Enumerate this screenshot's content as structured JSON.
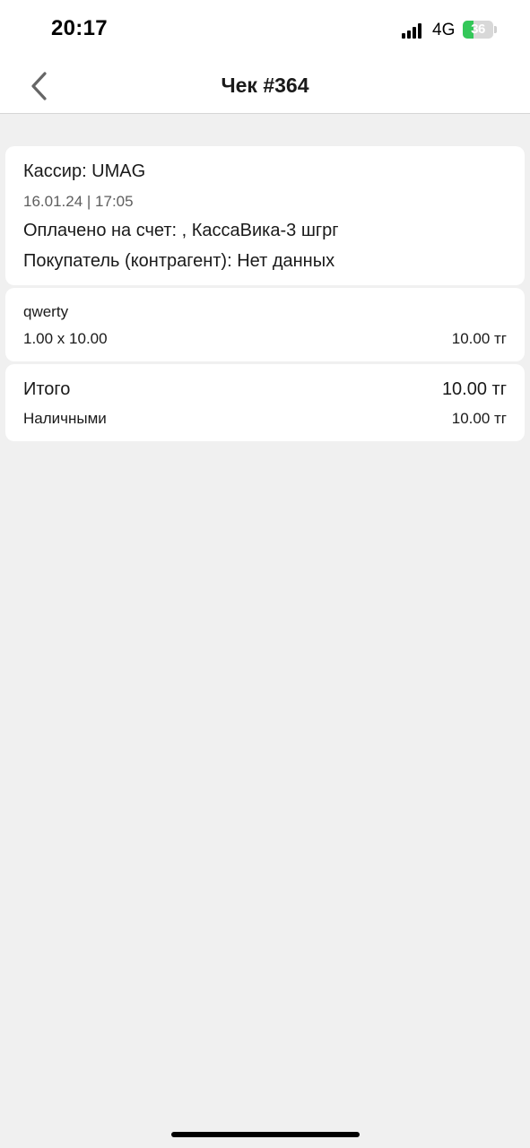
{
  "status_bar": {
    "time": "20:17",
    "network": "4G",
    "battery_level": "36",
    "battery_percent": 36
  },
  "nav": {
    "back_icon": "chevron-left-icon",
    "title": "Чек #364"
  },
  "receipt": {
    "cashier": "Кассир: UMAG",
    "datetime": "16.01.24 | 17:05",
    "paid_to": "Оплачено на счет: , КассаВика-3 шгрг",
    "buyer": "Покупатель (контрагент): Нет данных"
  },
  "items": [
    {
      "name": "qwerty",
      "qty_price": "1.00 x 10.00",
      "sum": "10.00 тг"
    }
  ],
  "totals": {
    "total_label": "Итого",
    "total_value": "10.00 тг",
    "payment_label": "Наличными",
    "payment_value": "10.00 тг"
  },
  "colors": {
    "background": "#f0f0f0",
    "card": "#ffffff",
    "battery": "#34c759",
    "muted_text": "#5e5e5e"
  }
}
